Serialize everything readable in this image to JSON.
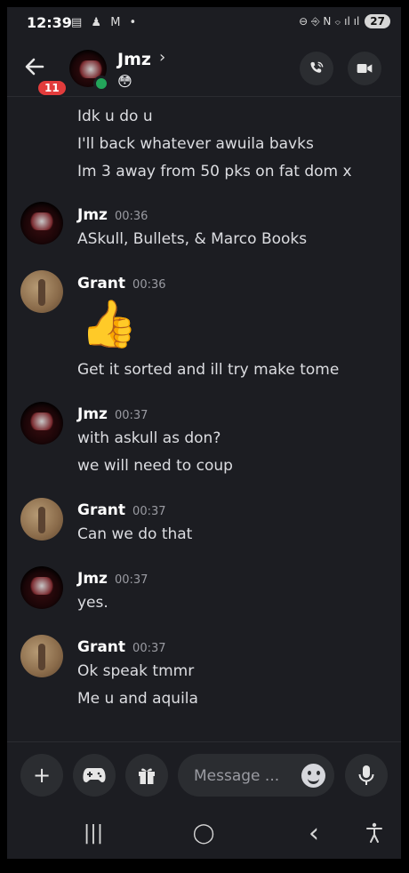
{
  "status_bar": {
    "time": "12:39",
    "left_icons": "▤ ♟ M •",
    "right_icons": "⊖ ⎆ N ⌔ ıl ıl",
    "battery": "27"
  },
  "header": {
    "back_badge": "11",
    "name": "Jmz",
    "chevron": "›",
    "status_emoji": "😳",
    "call_icon": "phone-icon",
    "video_icon": "video-icon"
  },
  "messages": {
    "top_continuation": [
      "Idk u do u",
      "I'll back whatever awuila bavks",
      "Im 3 away from 50 pks on fat dom x"
    ],
    "groups": [
      {
        "author": "Jmz",
        "time": "00:36",
        "lines": [
          "ASkull, Bullets, & Marco Books"
        ]
      },
      {
        "author": "Grant",
        "time": "00:36",
        "emoji": "👍",
        "lines": [
          "Get it sorted and ill try make tome"
        ]
      },
      {
        "author": "Jmz",
        "time": "00:37",
        "lines": [
          "with askull as don?",
          "we will need to coup"
        ]
      },
      {
        "author": "Grant",
        "time": "00:37",
        "lines": [
          "Can we do that"
        ]
      },
      {
        "author": "Jmz",
        "time": "00:37",
        "lines": [
          "yes."
        ]
      },
      {
        "author": "Grant",
        "time": "00:37",
        "lines": [
          "Ok speak tmmr",
          "Me u and aquila"
        ]
      }
    ]
  },
  "input_bar": {
    "plus": "+",
    "placeholder": "Message ..."
  },
  "nav_bar": {
    "recents": "|||",
    "home": "◯",
    "back": "‹",
    "accessibility": "accessibility-icon"
  },
  "colors": {
    "background": "#1c1d22",
    "online": "#23a55a",
    "badge": "#e23c3c"
  }
}
